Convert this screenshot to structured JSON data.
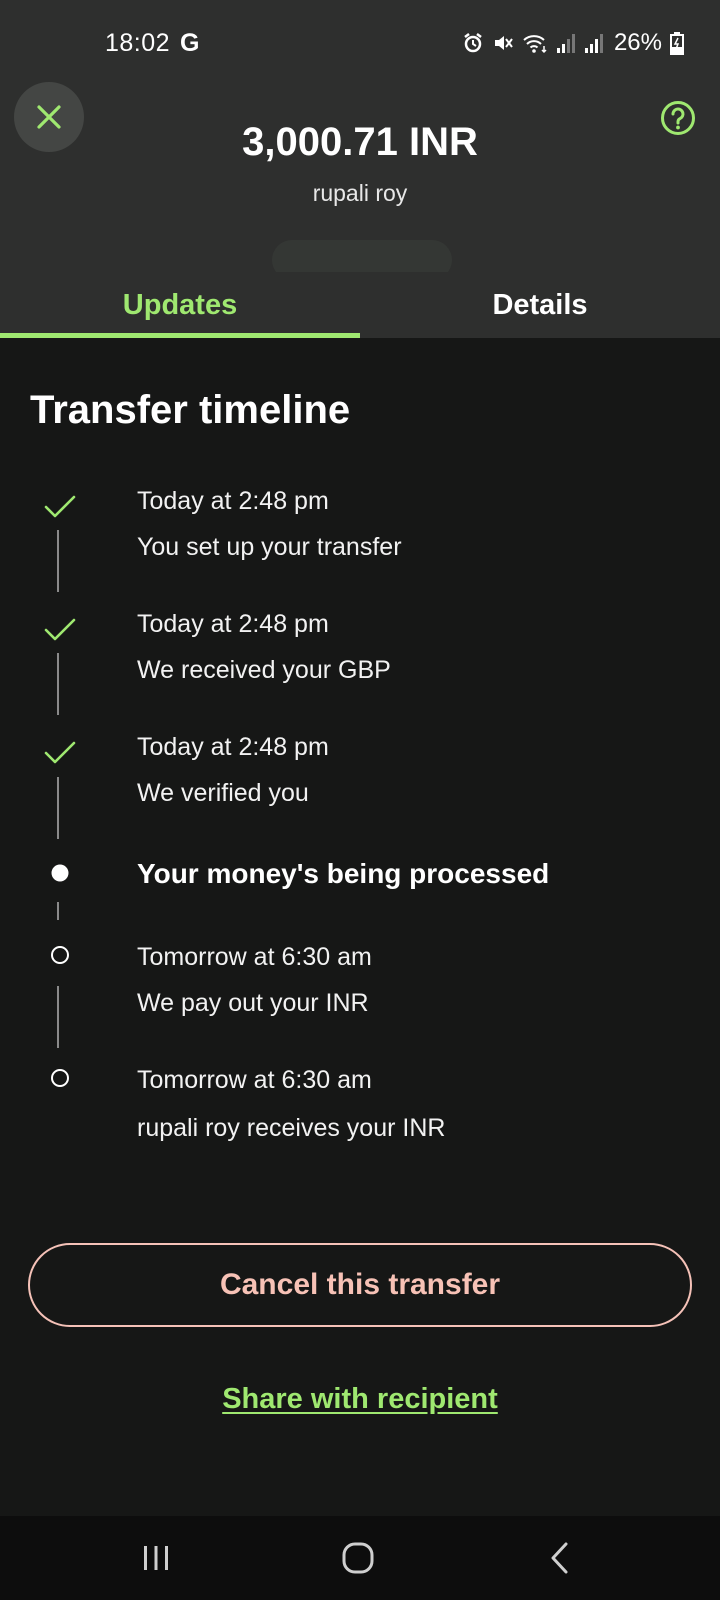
{
  "status_bar": {
    "time": "18:02",
    "g_label": "G",
    "battery": "26%"
  },
  "header": {
    "amount": "3,000.71 INR",
    "recipient": "rupali roy",
    "close_icon": "close-icon",
    "help_icon": "help-icon"
  },
  "tabs": [
    {
      "label": "Updates",
      "active": true
    },
    {
      "label": "Details",
      "active": false
    }
  ],
  "timeline": {
    "title": "Transfer timeline",
    "items": [
      {
        "status": "done",
        "time": "Today at 2:48 pm",
        "description": "You set up your transfer"
      },
      {
        "status": "done",
        "time": "Today at 2:48 pm",
        "description": "We received your GBP"
      },
      {
        "status": "done",
        "time": "Today at 2:48 pm",
        "description": "We verified you"
      },
      {
        "status": "current",
        "label": "Your money's being processed"
      },
      {
        "status": "pending",
        "time": "Tomorrow at 6:30 am",
        "description": "We pay out your INR"
      },
      {
        "status": "pending",
        "time": "Tomorrow at 6:30 am",
        "description": "rupali roy receives your INR"
      }
    ]
  },
  "actions": {
    "cancel_label": "Cancel this transfer",
    "share_label": "Share with recipient"
  },
  "colors": {
    "accent": "#9fe870",
    "cancel": "#f7c2b6",
    "background": "#161716",
    "header_bg": "#2e2f2e"
  }
}
